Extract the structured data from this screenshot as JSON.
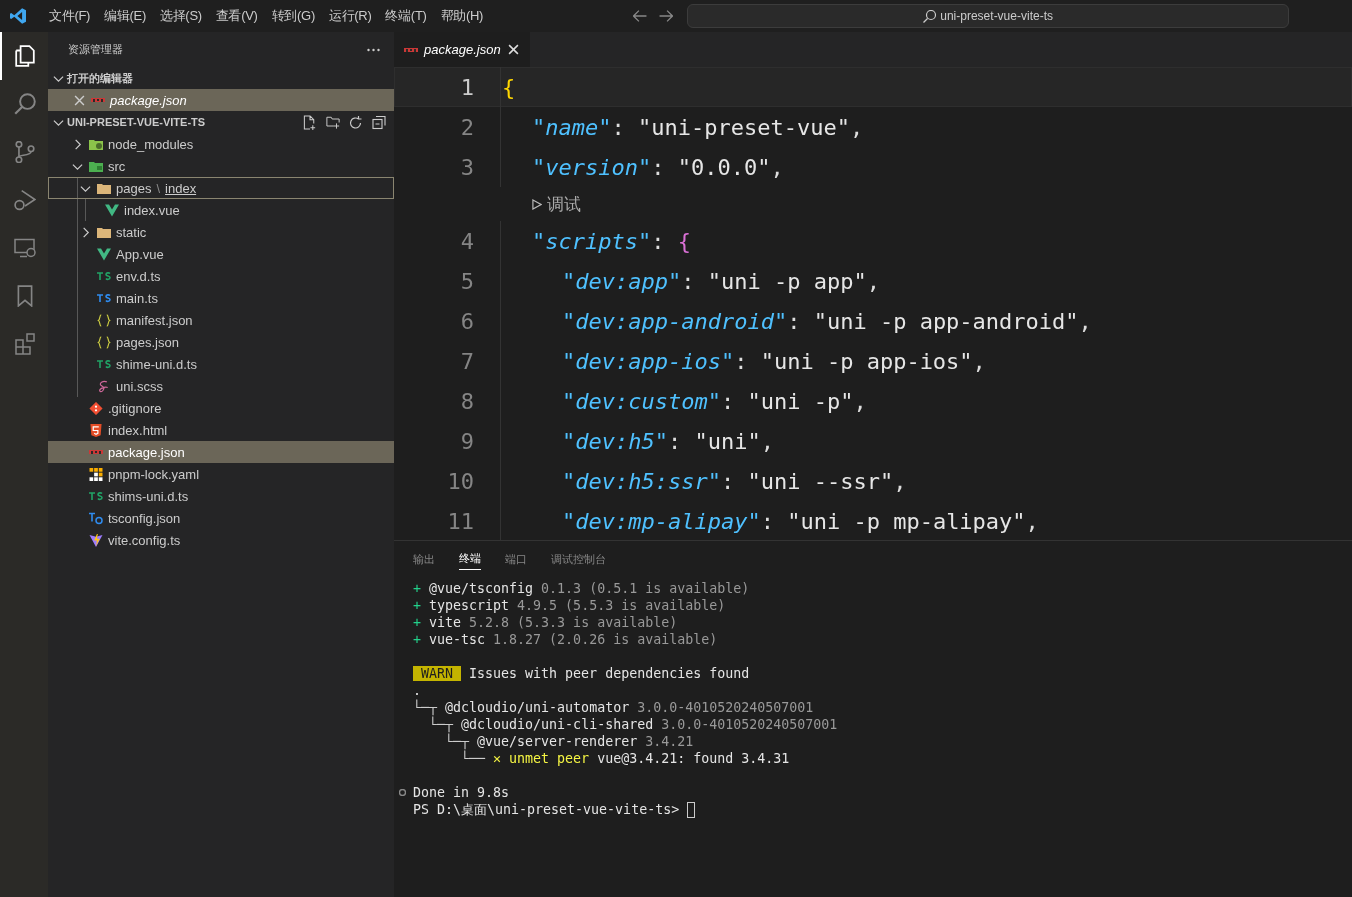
{
  "menu": [
    {
      "label": "文件(F)"
    },
    {
      "label": "编辑(E)"
    },
    {
      "label": "选择(S)"
    },
    {
      "label": "查看(V)"
    },
    {
      "label": "转到(G)"
    },
    {
      "label": "运行(R)"
    },
    {
      "label": "终端(T)"
    },
    {
      "label": "帮助(H)"
    }
  ],
  "command_center": {
    "text": "uni-preset-vue-vite-ts"
  },
  "activity_bar": [
    {
      "kind": "explorer",
      "selected": true
    },
    {
      "kind": "search",
      "selected": false
    },
    {
      "kind": "source-control",
      "selected": false
    },
    {
      "kind": "run-debug",
      "selected": false
    },
    {
      "kind": "remote",
      "selected": false
    },
    {
      "kind": "bookmark",
      "selected": false
    },
    {
      "kind": "extensions",
      "selected": false
    }
  ],
  "sidebar": {
    "title": "资源管理器",
    "open_editors": {
      "title": "打开的编辑器",
      "expanded": true,
      "items": [
        {
          "label": "package.json",
          "kind": "npm",
          "selected": true
        }
      ]
    },
    "project": {
      "title": "UNI-PRESET-VUE-VITE-TS",
      "expanded": true,
      "tree": [
        {
          "name": "node_modules",
          "kind": "folder-node",
          "expanded": false,
          "selected": false,
          "focused": false
        },
        {
          "name": "src",
          "kind": "folder-src",
          "expanded": true,
          "selected": false,
          "focused": false,
          "children": [
            {
              "name": "pages",
              "separator": "\\",
              "subname": "index",
              "kind": "folder",
              "expanded": true,
              "selected": false,
              "focused": true,
              "children": [
                {
                  "name": "index.vue",
                  "kind": "vue",
                  "selected": false,
                  "focused": false
                }
              ]
            },
            {
              "name": "static",
              "kind": "folder",
              "expanded": false,
              "selected": false,
              "focused": false
            },
            {
              "name": "App.vue",
              "kind": "vue",
              "selected": false,
              "focused": false
            },
            {
              "name": "env.d.ts",
              "kind": "ts-decl",
              "selected": false,
              "focused": false
            },
            {
              "name": "main.ts",
              "kind": "ts",
              "selected": false,
              "focused": false
            },
            {
              "name": "manifest.json",
              "kind": "json",
              "selected": false,
              "focused": false
            },
            {
              "name": "pages.json",
              "kind": "json",
              "selected": false,
              "focused": false
            },
            {
              "name": "shime-uni.d.ts",
              "kind": "ts-decl",
              "selected": false,
              "focused": false
            },
            {
              "name": "uni.scss",
              "kind": "scss",
              "selected": false,
              "focused": false
            }
          ]
        },
        {
          "name": ".gitignore",
          "kind": "git",
          "selected": false,
          "focused": false
        },
        {
          "name": "index.html",
          "kind": "html",
          "selected": false,
          "focused": false
        },
        {
          "name": "package.json",
          "kind": "npm",
          "selected": true,
          "focused": false
        },
        {
          "name": "pnpm-lock.yaml",
          "kind": "pnpm",
          "selected": false,
          "focused": false
        },
        {
          "name": "shims-uni.d.ts",
          "kind": "ts-decl",
          "selected": false,
          "focused": false
        },
        {
          "name": "tsconfig.json",
          "kind": "tsconfig",
          "selected": false,
          "focused": false
        },
        {
          "name": "vite.config.ts",
          "kind": "vite",
          "selected": false,
          "focused": false
        }
      ]
    }
  },
  "editor": {
    "tabs": [
      {
        "label": "package.json",
        "kind": "npm",
        "selected": true
      }
    ],
    "lines": [
      {
        "kind": "code",
        "number": "1",
        "current": true,
        "tokens": [
          {
            "kind": "brace",
            "text": "{"
          }
        ],
        "children": [
          {
            "kind": "code",
            "number": "2",
            "current": false,
            "tokens": [
              {
                "kind": "key",
                "text": "\"name\""
              },
              {
                "kind": "punct",
                "text": ": "
              },
              {
                "kind": "string",
                "text": "\"uni-preset-vue\""
              },
              {
                "kind": "punct",
                "text": ","
              }
            ]
          },
          {
            "kind": "code",
            "number": "3",
            "current": false,
            "tokens": [
              {
                "kind": "key",
                "text": "\"version\""
              },
              {
                "kind": "punct",
                "text": ": "
              },
              {
                "kind": "string",
                "text": "\"0.0.0\""
              },
              {
                "kind": "punct",
                "text": ","
              }
            ]
          },
          {
            "kind": "codelens",
            "text": "调试"
          },
          {
            "kind": "code",
            "number": "4",
            "current": false,
            "tokens": [
              {
                "kind": "key",
                "text": "\"scripts\""
              },
              {
                "kind": "punct",
                "text": ": "
              },
              {
                "kind": "brace2",
                "text": "{"
              }
            ],
            "children": [
              {
                "kind": "code",
                "number": "5",
                "current": false,
                "tokens": [
                  {
                    "kind": "key",
                    "text": "\"dev:app\""
                  },
                  {
                    "kind": "punct",
                    "text": ": "
                  },
                  {
                    "kind": "string",
                    "text": "\"uni -p app\""
                  },
                  {
                    "kind": "punct",
                    "text": ","
                  }
                ]
              },
              {
                "kind": "code",
                "number": "6",
                "current": false,
                "tokens": [
                  {
                    "kind": "key",
                    "text": "\"dev:app-android\""
                  },
                  {
                    "kind": "punct",
                    "text": ": "
                  },
                  {
                    "kind": "string",
                    "text": "\"uni -p app-android\""
                  },
                  {
                    "kind": "punct",
                    "text": ","
                  }
                ]
              },
              {
                "kind": "code",
                "number": "7",
                "current": false,
                "tokens": [
                  {
                    "kind": "key",
                    "text": "\"dev:app-ios\""
                  },
                  {
                    "kind": "punct",
                    "text": ": "
                  },
                  {
                    "kind": "string",
                    "text": "\"uni -p app-ios\""
                  },
                  {
                    "kind": "punct",
                    "text": ","
                  }
                ]
              },
              {
                "kind": "code",
                "number": "8",
                "current": false,
                "tokens": [
                  {
                    "kind": "key",
                    "text": "\"dev:custom\""
                  },
                  {
                    "kind": "punct",
                    "text": ": "
                  },
                  {
                    "kind": "string",
                    "text": "\"uni -p\""
                  },
                  {
                    "kind": "punct",
                    "text": ","
                  }
                ]
              },
              {
                "kind": "code",
                "number": "9",
                "current": false,
                "tokens": [
                  {
                    "kind": "key",
                    "text": "\"dev:h5\""
                  },
                  {
                    "kind": "punct",
                    "text": ": "
                  },
                  {
                    "kind": "string",
                    "text": "\"uni\""
                  },
                  {
                    "kind": "punct",
                    "text": ","
                  }
                ]
              },
              {
                "kind": "code",
                "number": "10",
                "current": false,
                "tokens": [
                  {
                    "kind": "key",
                    "text": "\"dev:h5:ssr\""
                  },
                  {
                    "kind": "punct",
                    "text": ": "
                  },
                  {
                    "kind": "string",
                    "text": "\"uni --ssr\""
                  },
                  {
                    "kind": "punct",
                    "text": ","
                  }
                ]
              },
              {
                "kind": "code",
                "number": "11",
                "current": false,
                "tokens": [
                  {
                    "kind": "key",
                    "text": "\"dev:mp-alipay\""
                  },
                  {
                    "kind": "punct",
                    "text": ": "
                  },
                  {
                    "kind": "string",
                    "text": "\"uni -p mp-alipay\""
                  },
                  {
                    "kind": "punct",
                    "text": ","
                  }
                ]
              }
            ]
          }
        ]
      }
    ]
  },
  "panel": {
    "tabs": [
      {
        "label": "输出",
        "selected": false
      },
      {
        "label": "终端",
        "selected": true
      },
      {
        "label": "端口",
        "selected": false
      },
      {
        "label": "调试控制台",
        "selected": false
      }
    ],
    "terminal": [
      {
        "kind": "text",
        "tokens": [
          {
            "kind": "plus",
            "text": "+ "
          },
          {
            "kind": "name",
            "text": "@vue/tsconfig"
          },
          {
            "kind": "dim",
            "text": " 0.1.3 (0.5.1 is available)"
          }
        ]
      },
      {
        "kind": "text",
        "tokens": [
          {
            "kind": "plus",
            "text": "+ "
          },
          {
            "kind": "name",
            "text": "typescript"
          },
          {
            "kind": "dim",
            "text": " 4.9.5 (5.5.3 is available)"
          }
        ]
      },
      {
        "kind": "text",
        "tokens": [
          {
            "kind": "plus",
            "text": "+ "
          },
          {
            "kind": "name",
            "text": "vite"
          },
          {
            "kind": "dim",
            "text": " 5.2.8 (5.3.3 is available)"
          }
        ]
      },
      {
        "kind": "text",
        "tokens": [
          {
            "kind": "plus",
            "text": "+ "
          },
          {
            "kind": "name",
            "text": "vue-tsc"
          },
          {
            "kind": "dim",
            "text": " 1.8.27 (2.0.26 is available)"
          }
        ]
      },
      {
        "kind": "blank"
      },
      {
        "kind": "text",
        "tokens": [
          {
            "kind": "badge",
            "text": "WARN"
          },
          {
            "kind": "name",
            "text": " Issues with peer dependencies found"
          }
        ]
      },
      {
        "kind": "text",
        "tokens": [
          {
            "kind": "name",
            "text": "."
          }
        ]
      },
      {
        "kind": "text",
        "tokens": [
          {
            "kind": "tree",
            "text": "└─┬ "
          },
          {
            "kind": "name",
            "text": "@dcloudio/uni-automator"
          },
          {
            "kind": "dim",
            "text": " 3.0.0-4010520240507001"
          }
        ]
      },
      {
        "kind": "text",
        "tokens": [
          {
            "kind": "tree",
            "text": "  └─┬ "
          },
          {
            "kind": "name",
            "text": "@dcloudio/uni-cli-shared"
          },
          {
            "kind": "dim",
            "text": " 3.0.0-4010520240507001"
          }
        ]
      },
      {
        "kind": "text",
        "tokens": [
          {
            "kind": "tree",
            "text": "    └─┬ "
          },
          {
            "kind": "name",
            "text": "@vue/server-renderer"
          },
          {
            "kind": "dim",
            "text": " 3.4.21"
          }
        ]
      },
      {
        "kind": "text",
        "tokens": [
          {
            "kind": "tree",
            "text": "      └── "
          },
          {
            "kind": "error",
            "text": "✕ unmet peer"
          },
          {
            "kind": "name",
            "text": " vue@3.4.21: found 3.4.31"
          }
        ]
      },
      {
        "kind": "blank"
      },
      {
        "kind": "text",
        "decoration": true,
        "tokens": [
          {
            "kind": "name",
            "text": "Done in 9.8s"
          }
        ]
      },
      {
        "kind": "text",
        "cursor": true,
        "tokens": [
          {
            "kind": "name",
            "text": "PS D:\\桌面\\uni-preset-vue-vite-ts> "
          }
        ]
      }
    ]
  }
}
